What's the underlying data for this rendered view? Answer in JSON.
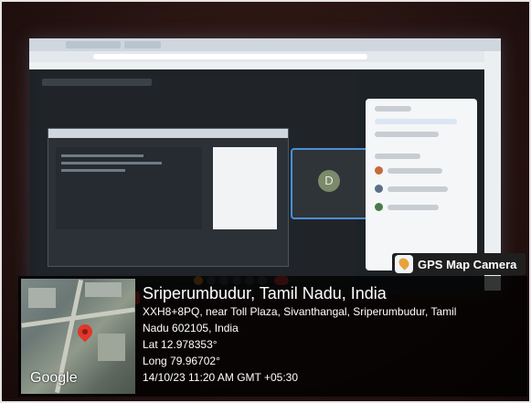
{
  "screen": {
    "participant_initial": "D"
  },
  "gps": {
    "badge_label": "GPS Map Camera",
    "map_label": "Google",
    "location_title": "Sriperumbudur, Tamil Nadu, India",
    "address_line1": "XXH8+8PQ, near Toll Plaza, Sivanthangal, Sriperumbudur, Tamil",
    "address_line2": "Nadu 602105, India",
    "lat": "Lat 12.978353°",
    "long": "Long 79.96702°",
    "timestamp": "14/10/23 11:20 AM GMT +05:30"
  },
  "colors": {
    "pin": "#e0362b",
    "accent_badge": "#e8a23a",
    "leave_button": "#d8382e"
  }
}
